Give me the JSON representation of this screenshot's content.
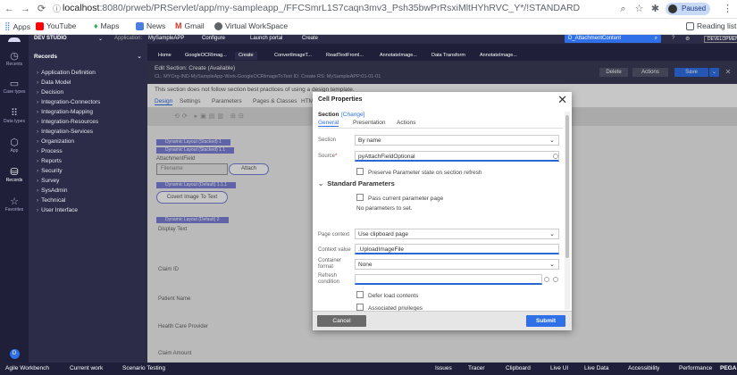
{
  "browser": {
    "url_host": "localhost",
    "url_path": ":8080/prweb/PRServlet/app/my-sampleapp_/FFCSmrL1S7caqn3mv3_Psh35bwPrRsxiMltHYhRVC_Y*/!STANDARD",
    "profile_label": "Paused",
    "bookmarks": [
      "Apps",
      "YouTube",
      "Maps",
      "News",
      "Gmail",
      "Virtual WorkSpace"
    ],
    "reading_list": "Reading list"
  },
  "appbar": {
    "studio": "DEV STUDIO",
    "application_label": "Application:",
    "application": "MySampleAPP",
    "configure": "Configure",
    "launch_portal": "Launch portal",
    "create": "Create",
    "search_value": "D_AttachmentContent",
    "dev_badge": "DEVELOPMENT"
  },
  "rail": [
    {
      "icon": "recents-icon",
      "label": "Recents"
    },
    {
      "icon": "case-types-icon",
      "label": "Case types"
    },
    {
      "icon": "data-types-icon",
      "label": "Data types"
    },
    {
      "icon": "app-icon",
      "label": "App"
    },
    {
      "icon": "records-icon",
      "label": "Records"
    },
    {
      "icon": "favorites-icon",
      "label": "Favorites"
    }
  ],
  "records": {
    "title": "Records",
    "items": [
      "Application Definition",
      "Data Model",
      "Decision",
      "Integration-Connectors",
      "Integration-Mapping",
      "Integration-Resources",
      "Integration-Services",
      "Organization",
      "Process",
      "Reports",
      "Security",
      "Survey",
      "SysAdmin",
      "Technical",
      "User Interface"
    ]
  },
  "tabs": [
    "Home",
    "GoogleOCRImag...",
    "Create",
    "ConvertImageT...",
    "ReadTextFroml...",
    "AnnotateImage...",
    "Data Transform",
    "AnnotateImage..."
  ],
  "header": {
    "title": "Edit  Section: Create (Available)",
    "subtitle": "CL: MYOrg-IND-MySampleApp-Work-GoogleOCRImageToText  ID: Create  RS: MySampleAPP:01-01-01",
    "delete": "Delete",
    "actions": "Actions",
    "save": "Save"
  },
  "warning": "This section does not follow section best practices of using a design template.",
  "subtabs": [
    "Design",
    "Settings",
    "Parameters",
    "Pages & Classes",
    "HTML"
  ],
  "canvas": {
    "dl1": "Dynamic Layout (Stacked)  1",
    "dl11": "Dynamic Layout (Stacked)  1.1",
    "attachment_field": "AttachmentField",
    "filename_placeholder": "Filename",
    "attach": "Attach",
    "dl111": "Dynamic Layout (Default)  1.1.1",
    "covert": "Covert Image To Text",
    "dl2": "Dynamic Layout (Default)  2",
    "display_text": "Display Text",
    "claim_id": "Claim ID",
    "patient_name": "Patient Name",
    "provider": "Health Care Provider",
    "claim_amount": "Claim Amount"
  },
  "modal": {
    "title": "Cell Properties",
    "section_label": "Section",
    "change_link": "[Change]",
    "tabs": [
      "General",
      "Presentation",
      "Actions"
    ],
    "section_field": "Section",
    "section_value": "By name",
    "source_label": "Source",
    "source_value": "pyAttachFieldOptional",
    "preserve": "Preserve Parameter state on section refresh",
    "std_params": "Standard Parameters",
    "pass_current": "Pass current parameter page",
    "no_params": "No parameters to set.",
    "page_context_label": "Page context",
    "page_context_value": "Use clipboard page",
    "context_value_label": "Context value",
    "context_value": ".UploadImageFile",
    "container_label": "Container format",
    "container_value": "None",
    "refresh_label": "Refresh condition",
    "defer": "Defer load contents",
    "assoc": "Associated privileges",
    "cancel": "Cancel",
    "submit": "Submit"
  },
  "status": [
    "Agile Workbench",
    "Current work",
    "Scenario Testing",
    "Issues",
    "Tracer",
    "Clipboard",
    "Live UI",
    "Live Data",
    "Accessibility",
    "Performance",
    "PEGA"
  ],
  "colors": {
    "accent": "#2f6fe8",
    "dark": "#1f1f3a",
    "panel": "#2c2c48",
    "layout": "#7b7fd8"
  }
}
